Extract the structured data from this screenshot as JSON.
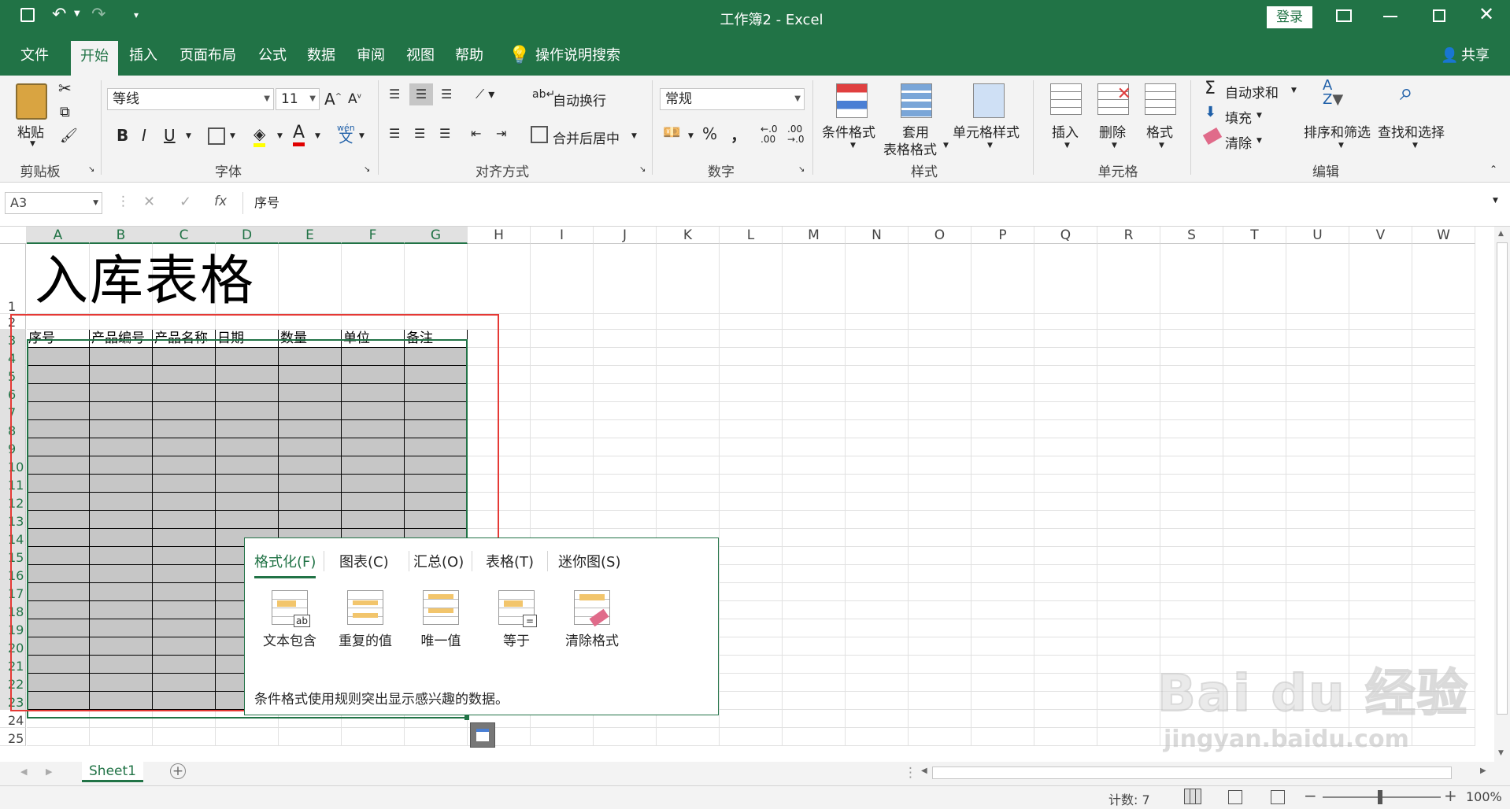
{
  "window": {
    "title": "工作簿2  -  Excel",
    "login_label": "登录",
    "share_label": "共享"
  },
  "tabs": [
    {
      "label": "文件"
    },
    {
      "label": "开始"
    },
    {
      "label": "插入"
    },
    {
      "label": "页面布局"
    },
    {
      "label": "公式"
    },
    {
      "label": "数据"
    },
    {
      "label": "审阅"
    },
    {
      "label": "视图"
    },
    {
      "label": "帮助"
    }
  ],
  "tell_me": "操作说明搜索",
  "ribbon": {
    "clipboard": {
      "paste": "粘贴",
      "group": "剪贴板"
    },
    "font": {
      "name": "等线",
      "size": "11",
      "group": "字体",
      "bold": "B",
      "italic": "I",
      "underline": "U",
      "phonetic": "wén",
      "phonetic2": "文"
    },
    "alignment": {
      "wrap": "自动换行",
      "merge": "合并后居中",
      "group": "对齐方式"
    },
    "number": {
      "format": "常规",
      "percent": "%",
      "comma": "，",
      "inc": ".00",
      "dec": ".0",
      "group": "数字"
    },
    "styles": {
      "cond": "条件格式",
      "table1": "套用",
      "table2": "表格格式",
      "cell": "单元格样式",
      "group": "样式"
    },
    "cells": {
      "insert": "插入",
      "delete": "删除",
      "format": "格式",
      "group": "单元格"
    },
    "editing": {
      "autosum": "自动求和",
      "fill": "填充",
      "clear": "清除",
      "sort": "排序和筛选",
      "find": "查找和选择",
      "group": "编辑"
    }
  },
  "formula": {
    "namebox": "A3",
    "fx": "fx",
    "content": "序号"
  },
  "columns": [
    "A",
    "B",
    "C",
    "D",
    "E",
    "F",
    "G",
    "H",
    "I",
    "J",
    "K",
    "L",
    "M",
    "N",
    "O",
    "P",
    "Q",
    "R",
    "S",
    "T",
    "U",
    "V",
    "W"
  ],
  "rows": [
    "1",
    "2",
    "3",
    "4",
    "5",
    "6",
    "7",
    "8",
    "9",
    "10",
    "11",
    "12",
    "13",
    "14",
    "15",
    "16",
    "17",
    "18",
    "19",
    "20",
    "21",
    "22",
    "23",
    "24",
    "25"
  ],
  "sheet_title": "入库表格",
  "table_headers": [
    "序号",
    "产品编号",
    "产品名称",
    "日期",
    "数量",
    "单位",
    "备注"
  ],
  "quick_analysis": {
    "tabs": [
      "格式化(F)",
      "图表(C)",
      "汇总(O)",
      "表格(T)",
      "迷你图(S)"
    ],
    "items": [
      "文本包含",
      "重复的值",
      "唯一值",
      "等于",
      "清除格式"
    ],
    "description": "条件格式使用规则突出显示感兴趣的数据。"
  },
  "sheet_tab": "Sheet1",
  "status": {
    "count": "计数: 7",
    "zoom": "100%"
  },
  "watermark": {
    "line1": "Bai du 经验",
    "line2": "jingyan.baidu.com"
  },
  "colors": {
    "brand": "#217346",
    "highlight": "#e53935",
    "table_fill": "#c6c6c6"
  }
}
